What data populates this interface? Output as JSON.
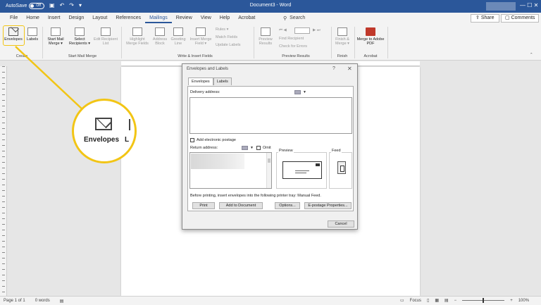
{
  "titlebar": {
    "autosave_label": "AutoSave",
    "toggle_state": "Off",
    "doc_title": "Document3  -  Word",
    "window_controls": "—  ☐  ✕"
  },
  "tabs": [
    {
      "label": "File"
    },
    {
      "label": "Home"
    },
    {
      "label": "Insert"
    },
    {
      "label": "Design"
    },
    {
      "label": "Layout"
    },
    {
      "label": "References"
    },
    {
      "label": "Mailings"
    },
    {
      "label": "Review"
    },
    {
      "label": "View"
    },
    {
      "label": "Help"
    },
    {
      "label": "Acrobat"
    }
  ],
  "active_tab": "Mailings",
  "search": {
    "label": "Search",
    "icon": "search-icon"
  },
  "share_label": "Share",
  "comments_label": "Comments",
  "ribbon": {
    "envelopes": "Envelopes",
    "labels": "Labels",
    "group_create": "Create",
    "start_mail_merge": "Start Mail Merge ▾",
    "select_recipients": "Select Recipients ▾",
    "edit_recipient_list": "Edit Recipient List",
    "group_start_mail_merge": "Start Mail Merge",
    "highlight_merge_fields": "Highlight Merge Fields",
    "address_block": "Address Block",
    "greeting_line": "Greeting Line",
    "insert_merge_field": "Insert Merge Field ▾",
    "rules": "Rules ▾",
    "match_fields": "Match Fields",
    "update_labels": "Update Labels",
    "group_write_insert": "Write & Insert Fields",
    "preview_results": "Preview Results",
    "find_recipient": "Find Recipient",
    "check_for_errors": "Check for Errors",
    "group_preview_results": "Preview Results",
    "finish_merge": "Finish & Merge ▾",
    "group_finish": "Finish",
    "merge_to_pdf": "Merge to Adobe PDF",
    "group_acrobat": "Acrobat"
  },
  "callout": {
    "label_envelopes": "Envelopes",
    "label_partial": "L",
    "accent": "#f2c515"
  },
  "dialog": {
    "title": "Envelopes and Labels",
    "help": "?",
    "close": "✕",
    "tab_envelopes": "Envelopes",
    "tab_labels": "Labels",
    "delivery_address_label": "Delivery address:",
    "delivery_address_value": "",
    "add_epostage": "Add electronic postage",
    "return_address_label": "Return address:",
    "omit": "Omit",
    "preview": "Preview",
    "feed": "Feed",
    "note": "Before printing, insert envelopes into the following printer tray: Manual Feed.",
    "btn_print": "Print",
    "btn_add_to_document": "Add to Document",
    "btn_options": "Options...",
    "btn_epostage_properties": "E-postage Properties...",
    "btn_cancel": "Cancel"
  },
  "status": {
    "page": "Page 1 of 1",
    "words": "0 words",
    "focus": "Focus",
    "zoom": "100%"
  },
  "colors": {
    "titlebar": "#2b579a",
    "ribbon": "#f3f3f3",
    "accent": "#f2c515"
  }
}
